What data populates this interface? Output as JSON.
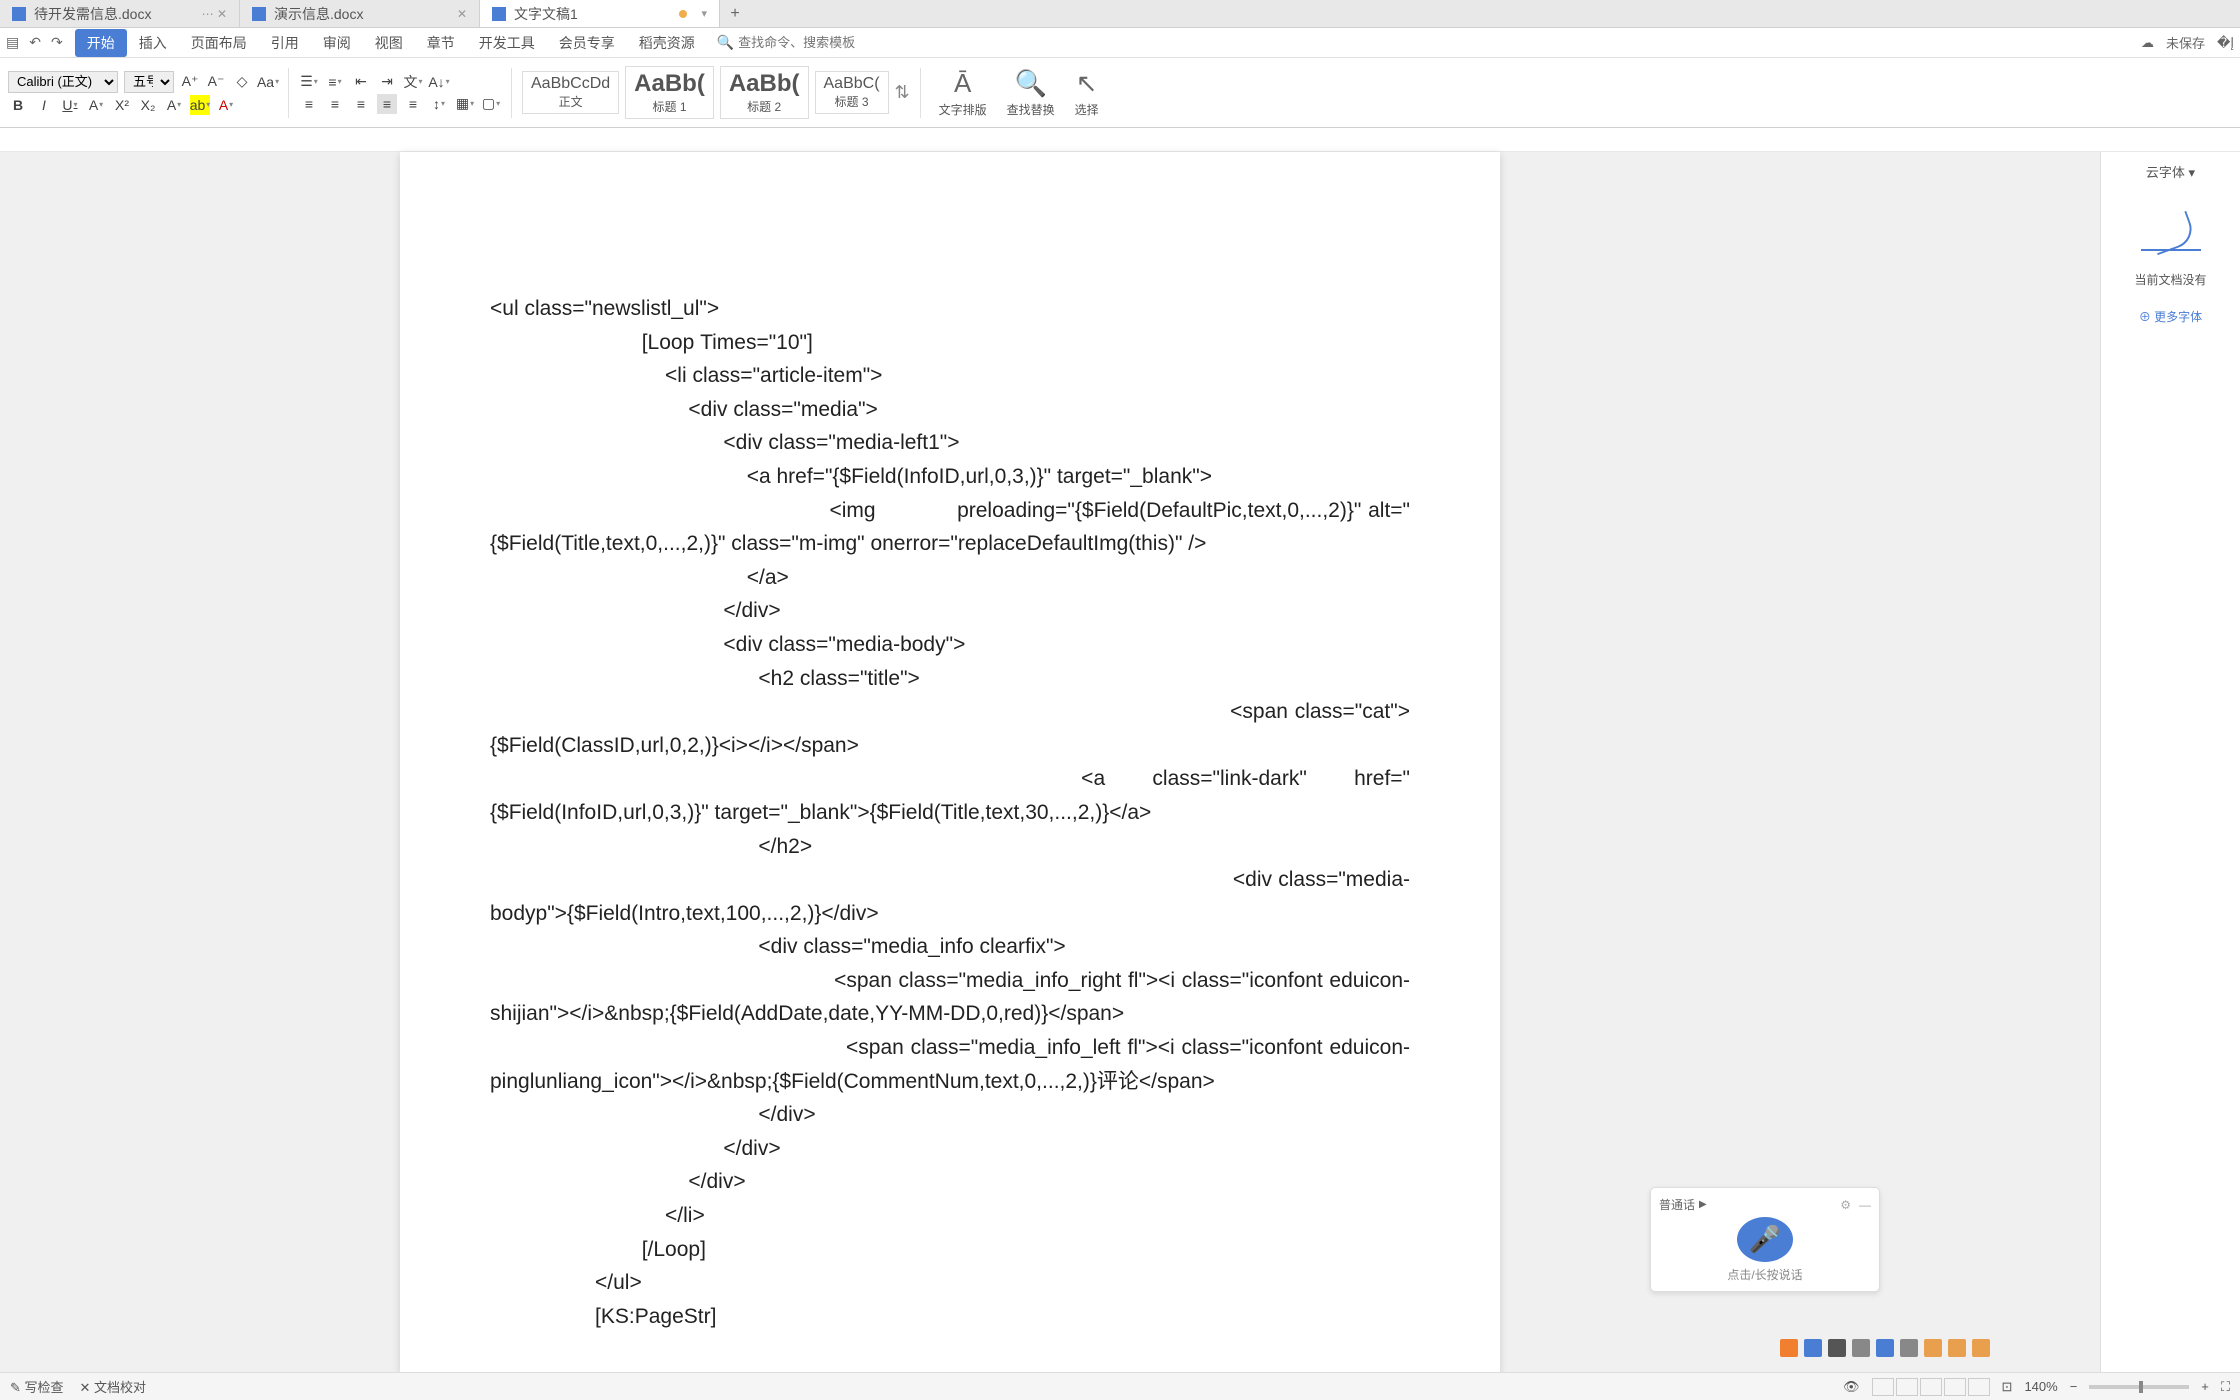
{
  "tabs": [
    {
      "label": "待开发需信息.docx",
      "active": false
    },
    {
      "label": "演示信息.docx",
      "active": false
    },
    {
      "label": "文字文稿1",
      "active": true,
      "unsaved": true
    }
  ],
  "menu": {
    "items": [
      "开始",
      "插入",
      "页面布局",
      "引用",
      "审阅",
      "视图",
      "章节",
      "开发工具",
      "会员专享",
      "稻壳资源"
    ],
    "active": "开始",
    "search_placeholder": "查找命令、搜索模板",
    "unsaved": "未保存"
  },
  "ribbon": {
    "font_name": "Calibri (正文)",
    "font_size": "五号",
    "styles": [
      {
        "sample": "AaBbCcDd",
        "label": "正文"
      },
      {
        "sample": "AaBb(",
        "label": "标题 1"
      },
      {
        "sample": "AaBb(",
        "label": "标题 2"
      },
      {
        "sample": "AaBbC(",
        "label": "标题 3"
      }
    ],
    "big_buttons": [
      {
        "label": "文字排版"
      },
      {
        "label": "查找替换"
      },
      {
        "label": "选择"
      }
    ]
  },
  "right_panel": {
    "dropdown": "云字体",
    "msg": "当前文档没有",
    "link": "更多字体"
  },
  "voice": {
    "lang": "普通话",
    "hint": "点击/长按说话"
  },
  "status": {
    "left1": "写检查",
    "left2": "文档校对",
    "zoom": "140%"
  },
  "doc_lines": [
    "<ul class=\"newslistl_ul\">",
    "                          [Loop Times=\"10\"]",
    "                              <li class=\"article-item\">",
    "                                  <div class=\"media\">",
    "                                        <div class=\"media-left1\">",
    "                                            <a href=\"{$Field(InfoID,url,0,3,)}\" target=\"_blank\">",
    "                                                  <img            preloading=\"{$Field(DefaultPic,text,0,...,2)}\" alt=\"{$Field(Title,text,0,...,2,)}\" class=\"m-img\" onerror=\"replaceDefaultImg(this)\" />",
    "                                            </a>",
    "                                        </div>",
    "                                        <div class=\"media-body\">",
    "                                              <h2 class=\"title\">",
    "                                                                                                              <span class=\"cat\">{$Field(ClassID,url,0,2,)}<i></i></span>",
    "                                                  <a    class=\"link-dark\"    href=\"{$Field(InfoID,url,0,3,)}\" target=\"_blank\">{$Field(Title,text,30,...,2,)}</a>",
    "                                              </h2>",
    "                                                                                                                       <div class=\"media-bodyp\">{$Field(Intro,text,100,...,2,)}</div>",
    "                                              <div class=\"media_info clearfix\">",
    "                                                    <span class=\"media_info_right fl\"><i class=\"iconfont eduicon-shijian\"></i>&nbsp;{$Field(AddDate,date,YY-MM-DD,0,red)}</span>",
    "                                                    <span class=\"media_info_left fl\"><i class=\"iconfont eduicon-pinglunliang_icon\"></i>&nbsp;{$Field(CommentNum,text,0,...,2,)}评论</span>",
    "                                              </div>",
    "                                        </div>",
    "                                  </div>",
    "                              </li>",
    "                          [/Loop]",
    "                  </ul>",
    "                  [KS:PageStr]"
  ]
}
